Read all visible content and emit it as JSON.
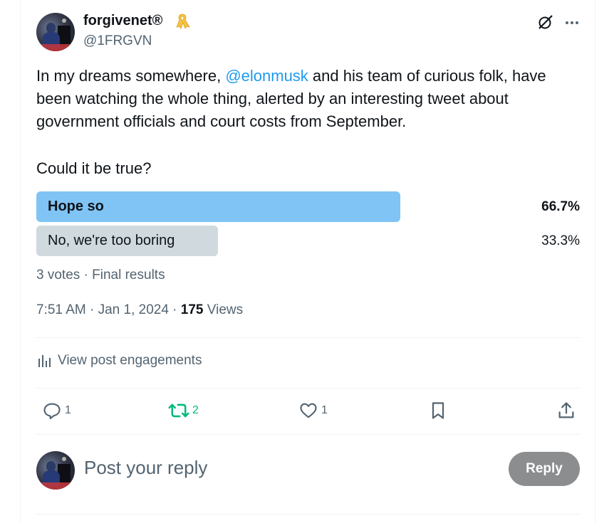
{
  "post": {
    "display_name": "forgivenet®",
    "handle": "@1FRGVN",
    "text_before_mention": "In my dreams somewhere, ",
    "mention": "@elonmusk",
    "text_after_mention": " and his team of curious folk, have",
    "text_line2": "been watching the whole thing, alerted by an interesting tweet about",
    "text_line3": "government officials and court costs from September.",
    "question": "Could it be true?"
  },
  "poll": {
    "options": [
      {
        "label": "Hope so",
        "percent": "66.7%",
        "value": 66.7,
        "winner": true
      },
      {
        "label": "No, we're too boring",
        "percent": "33.3%",
        "value": 33.3,
        "winner": false
      }
    ],
    "summary": "3 votes · Final results"
  },
  "meta": {
    "time": "7:51 AM · Jan 1, 2024 · ",
    "views_count": "175",
    "views_label": " Views"
  },
  "engagements_label": "View post engagements",
  "actions": {
    "replies": "1",
    "reposts": "2",
    "likes": "1"
  },
  "reply_box": {
    "placeholder": "Post your reply",
    "button_label": "Reply"
  },
  "colors": {
    "accent": "#1d9bf0",
    "winner_bar": "#7fc4f5",
    "other_bar": "#cfd9de",
    "repost_green": "#00ba7c",
    "reply_button": "#8b8d8f"
  },
  "icons": [
    "yellow-ribbon-icon",
    "grok-icon",
    "more-icon",
    "analytics-icon",
    "reply-icon",
    "repost-icon",
    "like-icon",
    "bookmark-icon",
    "share-icon"
  ]
}
